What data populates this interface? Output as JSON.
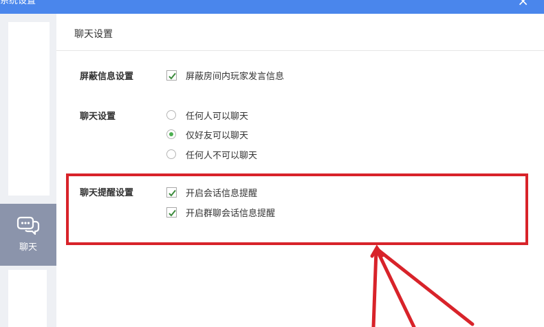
{
  "window": {
    "title": "系统设置",
    "close_glyph": "×"
  },
  "sidebar": {
    "active_item": {
      "label": "聊天",
      "icon": "chat-bubble-icon"
    }
  },
  "page": {
    "title": "聊天设置"
  },
  "sections": {
    "block": {
      "label": "屏蔽信息设置",
      "options": [
        {
          "label": "屏蔽房间内玩家发言信息",
          "checked": true
        }
      ]
    },
    "chat": {
      "label": "聊天设置",
      "options": [
        {
          "label": "任何人可以聊天",
          "selected": false
        },
        {
          "label": "仅好友可以聊天",
          "selected": true
        },
        {
          "label": "任何人不可以聊天",
          "selected": false
        }
      ]
    },
    "reminder": {
      "label": "聊天提醒设置",
      "options": [
        {
          "label": "开启会话信息提醒",
          "checked": true
        },
        {
          "label": "开启群聊会话信息提醒",
          "checked": true
        }
      ]
    }
  },
  "colors": {
    "titlebar": "#4a86ec",
    "sidebar_active": "#8b94ab",
    "annotation": "#d8232a",
    "radio_selected": "#4caf50",
    "check_mark": "#3d8b3d"
  }
}
